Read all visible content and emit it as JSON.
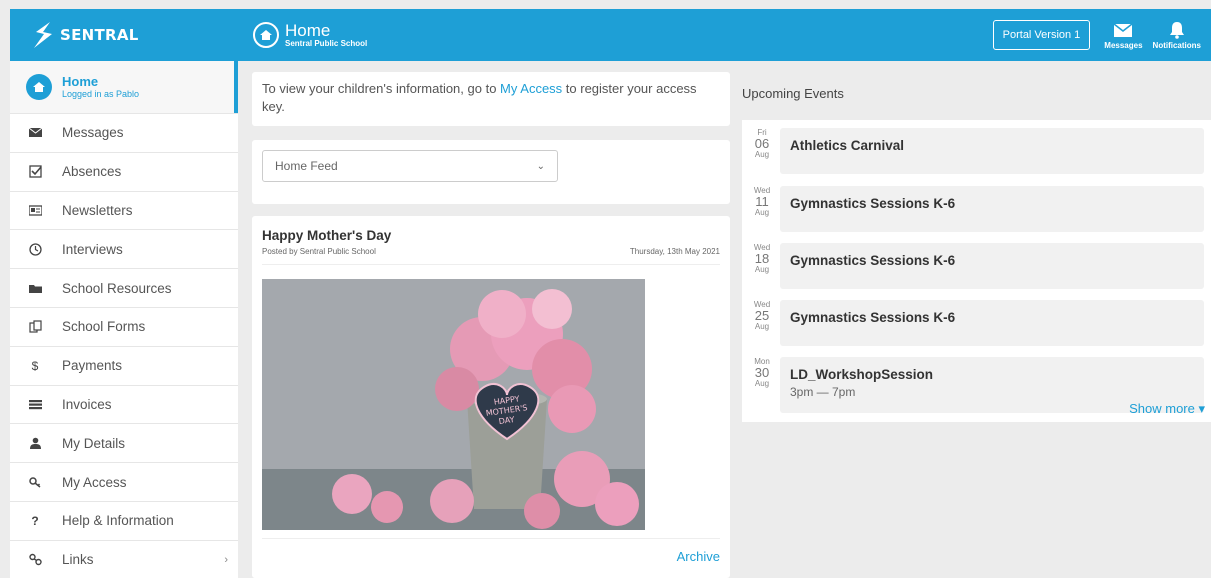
{
  "brand": {
    "name": "SENTRAL"
  },
  "header": {
    "title": "Home",
    "subtitle": "Sentral Public School",
    "portal_button": "Portal Version 1",
    "messages_label": "Messages",
    "notifications_label": "Notifications"
  },
  "sidebar": {
    "home": {
      "title": "Home",
      "subtitle": "Logged in as Pablo"
    },
    "items": [
      {
        "label": "Messages",
        "icon": "envelope-icon"
      },
      {
        "label": "Absences",
        "icon": "checkbox-icon"
      },
      {
        "label": "Newsletters",
        "icon": "newspaper-icon"
      },
      {
        "label": "Interviews",
        "icon": "clock-icon"
      },
      {
        "label": "School Resources",
        "icon": "folder-icon"
      },
      {
        "label": "School Forms",
        "icon": "forms-icon"
      },
      {
        "label": "Payments",
        "icon": "dollar-icon"
      },
      {
        "label": "Invoices",
        "icon": "list-icon"
      },
      {
        "label": "My Details",
        "icon": "user-icon"
      },
      {
        "label": "My Access",
        "icon": "key-icon"
      },
      {
        "label": "Help & Information",
        "icon": "question-icon"
      },
      {
        "label": "Links",
        "icon": "link-icon"
      }
    ]
  },
  "intro": {
    "before": "To view your children's information, go to ",
    "link": "My Access",
    "after": " to register your access key."
  },
  "feed": {
    "selected": "Home Feed"
  },
  "post": {
    "title": "Happy Mother's Day",
    "posted_by": "Posted by Sentral Public School",
    "date": "Thursday, 13th May 2021",
    "image_text": [
      "HAPPY",
      "MOTHER'S",
      "DAY"
    ],
    "archive": "Archive"
  },
  "events": {
    "title": "Upcoming Events",
    "items": [
      {
        "dow": "Fri",
        "day": "06",
        "month": "Aug",
        "name": "Athletics Carnival",
        "time": ""
      },
      {
        "dow": "Wed",
        "day": "11",
        "month": "Aug",
        "name": "Gymnastics Sessions K-6",
        "time": ""
      },
      {
        "dow": "Wed",
        "day": "18",
        "month": "Aug",
        "name": "Gymnastics Sessions K-6",
        "time": ""
      },
      {
        "dow": "Wed",
        "day": "25",
        "month": "Aug",
        "name": "Gymnastics Sessions K-6",
        "time": ""
      },
      {
        "dow": "Mon",
        "day": "30",
        "month": "Aug",
        "name": "LD_WorkshopSession",
        "time": "3pm — 7pm"
      }
    ],
    "show_more": "Show more ▾"
  },
  "colors": {
    "accent": "#1e9fd6",
    "background": "#ececec"
  }
}
